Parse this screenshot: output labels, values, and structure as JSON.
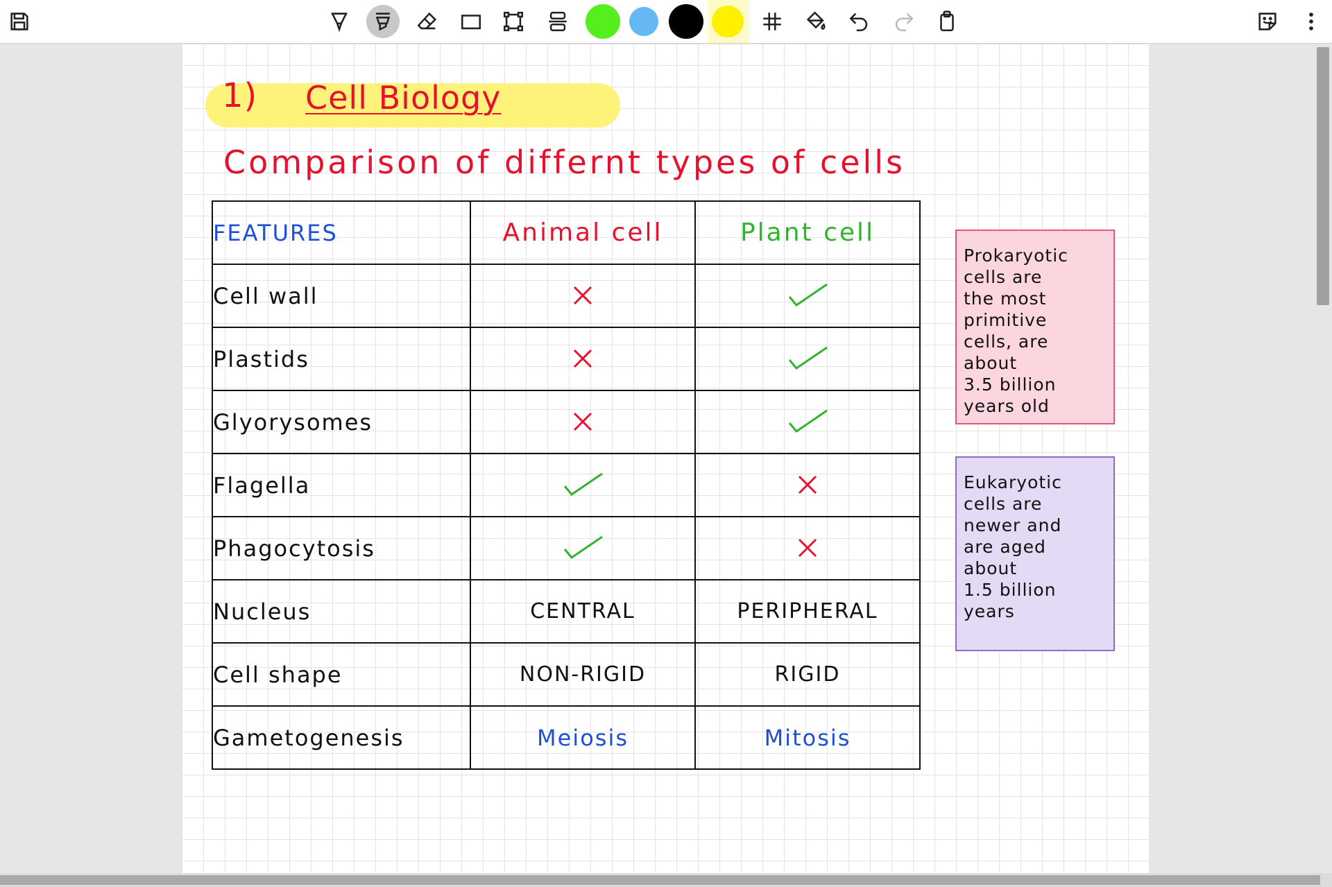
{
  "toolbar": {
    "left_icon": "save-icon",
    "tools": [
      "pen-icon",
      "highlighter-icon",
      "eraser-icon",
      "shape-icon",
      "lasso-select-icon",
      "insert-space-icon"
    ],
    "active_tool": "highlighter-icon",
    "colors": [
      "#55ee1e",
      "#66b8f5",
      "#000000",
      "#fff000"
    ],
    "selected_color": "#fff000",
    "right_tools": [
      "grid-icon",
      "fill-icon",
      "undo-icon",
      "redo-icon",
      "clipboard-icon"
    ],
    "far_right": [
      "sticky-note-icon",
      "more-vert-icon"
    ]
  },
  "note": {
    "number": "1)",
    "title": "Cell Biology",
    "subtitle": "Comparison of differnt types of cells",
    "table": {
      "headers": [
        "FEATURES",
        "Animal cell",
        "Plant cell"
      ],
      "rows": [
        {
          "feature": "Cell wall",
          "animal": "✗",
          "plant": "✓"
        },
        {
          "feature": "Plastids",
          "animal": "✗",
          "plant": "✓"
        },
        {
          "feature": "Glyorysomes",
          "animal": "✗",
          "plant": "✓"
        },
        {
          "feature": "Flagella",
          "animal": "✓",
          "plant": "✗"
        },
        {
          "feature": "Phagocytosis",
          "animal": "✓",
          "plant": "✗"
        },
        {
          "feature": "Nucleus",
          "animal": "CENTRAL",
          "plant": "PERIPHERAL"
        },
        {
          "feature": "Cell shape",
          "animal": "NON-RIGID",
          "plant": "RIGID"
        },
        {
          "feature": "Gametogenesis",
          "animal": "Meiosis",
          "plant": "Mitosis"
        }
      ]
    },
    "sticky_pink": [
      "Prokaryotic",
      "cells are",
      "the most",
      "primitive",
      "cells, are",
      "about",
      "3.5 billion",
      "years old"
    ],
    "sticky_purple": [
      "Eukaryotic",
      "cells are",
      "newer and",
      "are aged",
      "about",
      "1.5 billion",
      "years"
    ],
    "colors": {
      "red": "#e8112d",
      "green": "#2fb52b",
      "blue": "#1d4fd6",
      "highlight": "#fdf37a"
    }
  }
}
